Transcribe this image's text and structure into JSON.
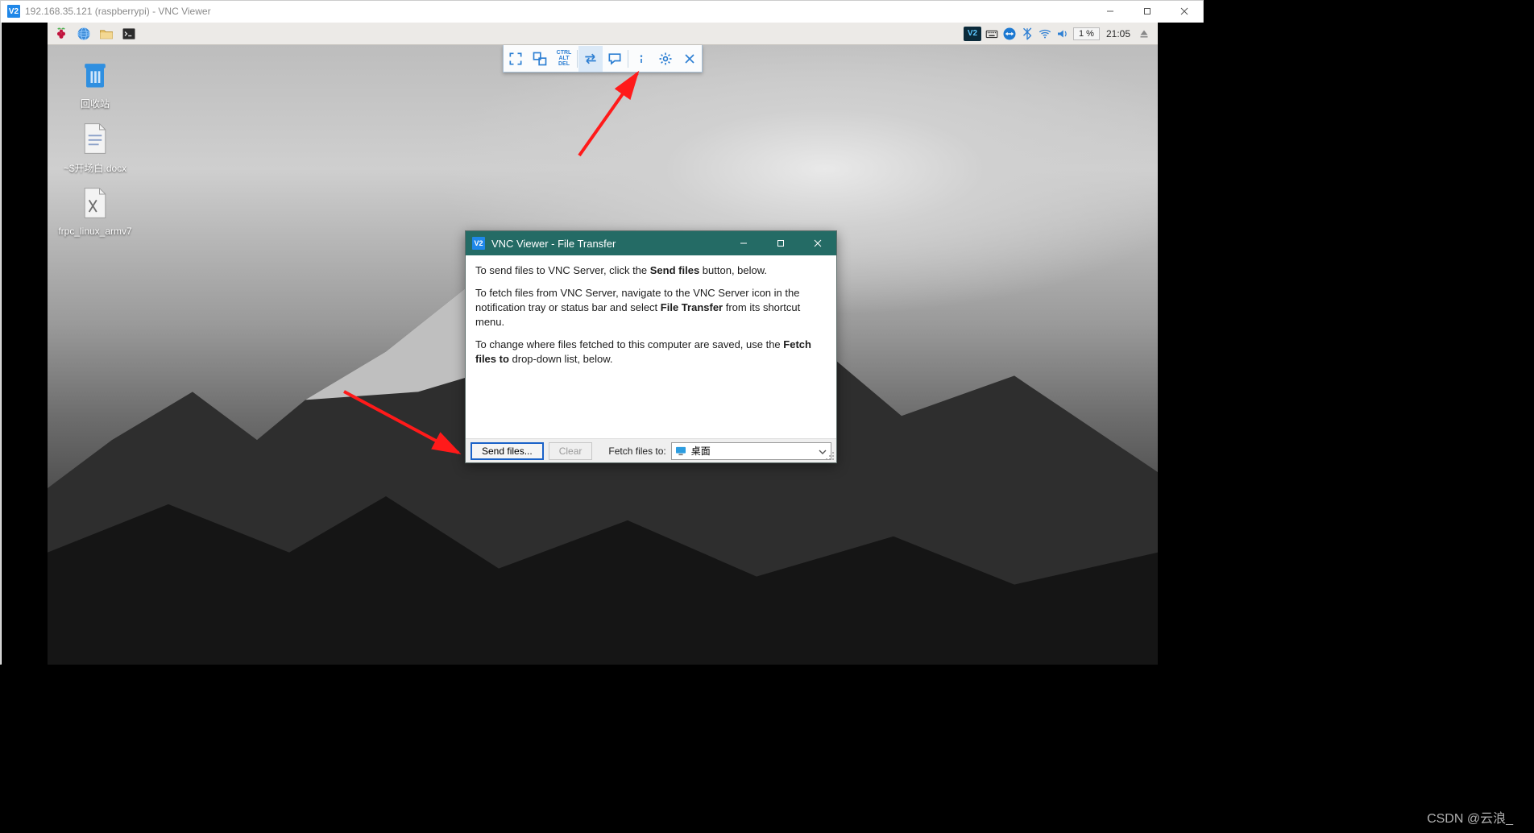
{
  "host_window": {
    "app_badge": "V2",
    "title": "192.168.35.121 (raspberrypi) - VNC Viewer"
  },
  "remote_panel": {
    "tray_percent": "1 %",
    "tray_time": "21:05",
    "vnc_badge": "V2"
  },
  "desktop_icons": {
    "trash_label": "回收站",
    "docx_label": "~$开场白.docx",
    "frpc_label": "frpc_linux_armv7"
  },
  "vnc_toolbar": {
    "ctrl": "CTRL",
    "alt": "ALT",
    "del": "DEL"
  },
  "file_transfer": {
    "icon_badge": "V2",
    "title": "VNC Viewer - File Transfer",
    "p1_a": "To send files to VNC Server, click the ",
    "p1_bold": "Send files",
    "p1_b": " button, below.",
    "p2_a": "To fetch files from VNC Server, navigate to the VNC Server icon in the notification tray or status bar and select ",
    "p2_bold": "File Transfer",
    "p2_b": " from its shortcut menu.",
    "p3_a": "To change where files fetched to this computer are saved, use the ",
    "p3_bold": "Fetch files to",
    "p3_b": " drop-down list, below.",
    "send_btn": "Send files...",
    "clear_btn": "Clear",
    "fetch_label": "Fetch files to:",
    "fetch_value": "桌面"
  },
  "watermark": "CSDN @云浪_"
}
